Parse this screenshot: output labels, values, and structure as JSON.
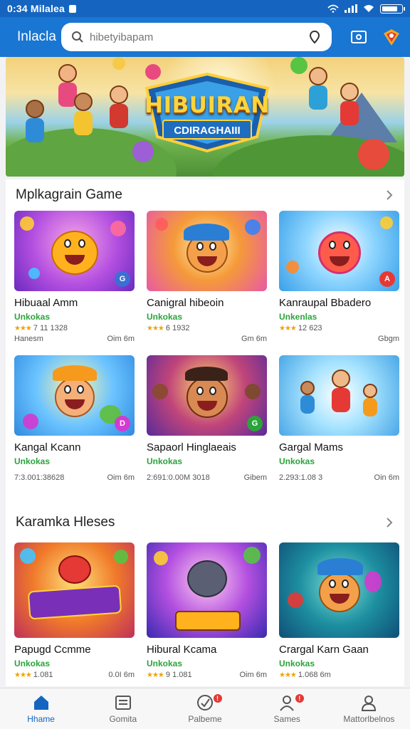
{
  "status_bar": {
    "time": "0:34 Milalea"
  },
  "app_bar": {
    "title": "Inlacla",
    "search_placeholder": "hibetyibapam"
  },
  "banner": {
    "title": "HIBUIRAN",
    "subtitle": "CDIRAGHAIII"
  },
  "sections": [
    {
      "title": "Mplkagrain Game",
      "games": [
        {
          "name": "Hibuaal Amm",
          "sub": "Unkokas",
          "rating": "7 11 1328",
          "left": "Hanesm",
          "right": "Oim 6m"
        },
        {
          "name": "Canigral hibeoin",
          "sub": "Unkokas",
          "rating": "6 1932",
          "left": "",
          "right": "Gm 6m"
        },
        {
          "name": "Kanraupal Bbadero",
          "sub": "Unkenlas",
          "rating": "12 623",
          "left": "",
          "right": "Gbgm"
        },
        {
          "name": "Kangal Kcann",
          "sub": "Unkokas",
          "rating": "",
          "left": "7:3.001:38628",
          "right": "Oim 6m"
        },
        {
          "name": "Sapaorl Hinglaeais",
          "sub": "Unkokas",
          "rating": "",
          "left": "2:691:0.00M 3018",
          "right": "Gibem"
        },
        {
          "name": "Gargal Mams",
          "sub": "Unkokas",
          "rating": "",
          "left": "2.293:1.08 3",
          "right": "Oin 6m"
        }
      ]
    },
    {
      "title": "Karamka Hleses",
      "games": [
        {
          "name": "Papugd Ccmme",
          "sub": "Unkokas",
          "rating": "1.081",
          "left": "",
          "right": "0.0I 6m"
        },
        {
          "name": "Hibural Kcama",
          "sub": "Unkokas",
          "rating": "9 1.081",
          "left": "",
          "right": "Oim 6m"
        },
        {
          "name": "Crargal Karn Gaan",
          "sub": "Unkokas",
          "rating": "1.068 6m",
          "left": "",
          "right": ""
        }
      ]
    }
  ],
  "bottom_nav": [
    {
      "label": "Hhame",
      "active": true
    },
    {
      "label": "Gomita",
      "active": false
    },
    {
      "label": "Palbeme",
      "active": false,
      "badge": "!"
    },
    {
      "label": "Sames",
      "active": false,
      "badge": "!"
    },
    {
      "label": "Mattorlbelnos",
      "active": false
    }
  ],
  "colors": {
    "primary": "#1976d2",
    "status": "#1565c0",
    "green": "#2aa43a",
    "star": "#f2a100"
  }
}
